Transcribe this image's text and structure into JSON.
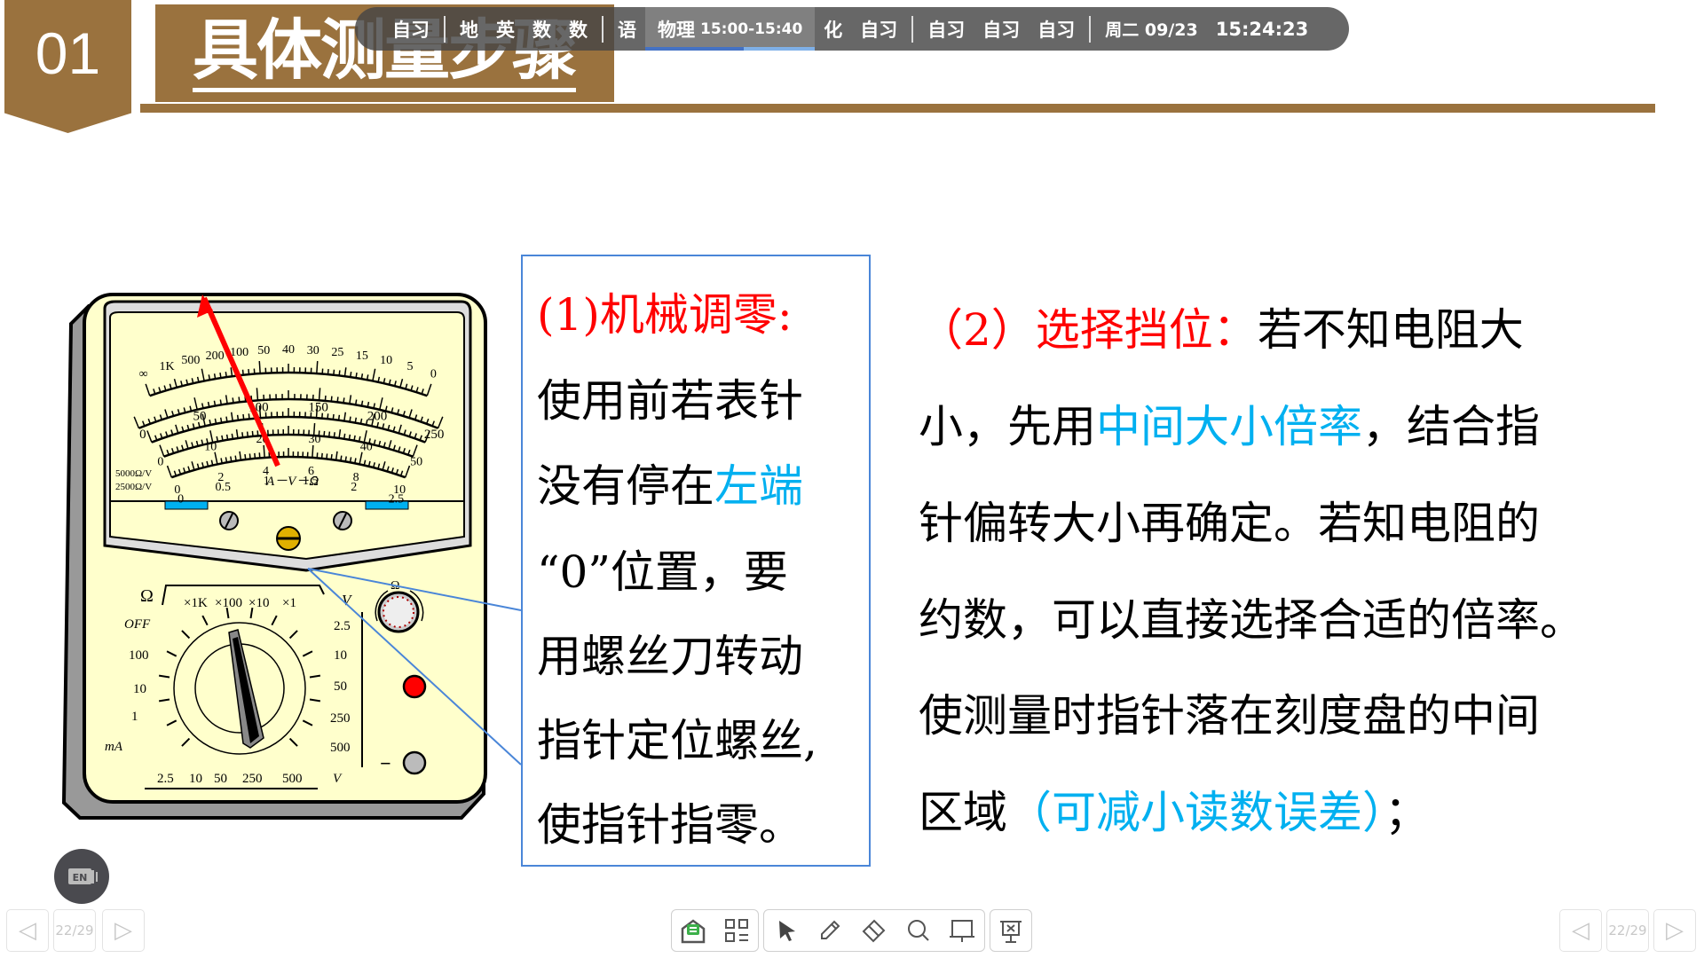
{
  "header": {
    "section_number": "01",
    "title": "具体测量步骤",
    "accent_color": "#9a723e"
  },
  "schedule_bar": {
    "items": [
      "自习",
      "地",
      "英",
      "数",
      "数",
      "语"
    ],
    "current": {
      "subject": "物理",
      "time": "15:00-15:40"
    },
    "after": [
      "化",
      "自习"
    ],
    "evening": [
      "自习",
      "自习",
      "自习"
    ],
    "date": "周二 09/23",
    "clock": "15:24:23"
  },
  "step1": {
    "heading": "(1)机械调零:",
    "lines": [
      "使用前若表针",
      "没有停在",
      "“0”位置，要",
      "用螺丝刀转动",
      "指针定位螺丝,",
      "使指针指零。"
    ],
    "highlight": "左端"
  },
  "step2": {
    "heading": "（2）选择挡位：",
    "l1": "若不知电阻大",
    "l2a": "小，先用",
    "l2b": "中间大小倍率",
    "l2c": "，结合指",
    "l3": "针偏转大小再确定。若知电阻的",
    "l4": "约数，可以直接选择合适的倍率。",
    "l5": "使测量时指针落在刻度盘的中间",
    "l6a": "区域",
    "l6b": "（可减小读数误差）",
    "l6c": "；"
  },
  "colors": {
    "heading_red": "#ff0000",
    "highlight_blue": "#00b0f0",
    "box_border": "#4a86d8"
  },
  "multimeter": {
    "ohm_scale": [
      "∞",
      "1K",
      "500",
      "200",
      "100",
      "50",
      "40",
      "30",
      "25",
      "15",
      "10",
      "5",
      "0"
    ],
    "dc_scale": [
      "0",
      "50",
      "100",
      "150",
      "200",
      "250"
    ],
    "v10_scale": [
      "0",
      "10",
      "20",
      "30",
      "40",
      "50"
    ],
    "v2_scale": [
      "0",
      "2",
      "4",
      "6",
      "8",
      "10"
    ],
    "ac_scale": [
      "0",
      "0.5",
      "1",
      "1.5",
      "2",
      "2.5"
    ],
    "dial_label": "A－V－Ω",
    "sensitivity": [
      "5000Ω/V",
      "2500Ω/V"
    ],
    "range_header": [
      "Ω",
      "×1K",
      "×100",
      "×10",
      "×1"
    ],
    "left_ranges": [
      "OFF",
      "100",
      "10",
      "1",
      "mA"
    ],
    "right_ranges": [
      "2.5",
      "10",
      "50",
      "250",
      "500"
    ],
    "bottom_ranges": [
      "2.5",
      "10",
      "50",
      "250",
      "500",
      "V"
    ],
    "v_label": "V",
    "omega_adj": "Ω",
    "minus": "−"
  },
  "input_method": {
    "label": "EN",
    "icon": "keyboard-language-icon"
  },
  "page_nav": {
    "page": "22/29"
  },
  "toolbar": {
    "icons": [
      "homework-icon",
      "apps-grid-icon",
      "pointer-icon",
      "pen-icon",
      "eraser-icon",
      "search-icon",
      "whiteboard-icon",
      "exit-presentation-icon"
    ]
  }
}
